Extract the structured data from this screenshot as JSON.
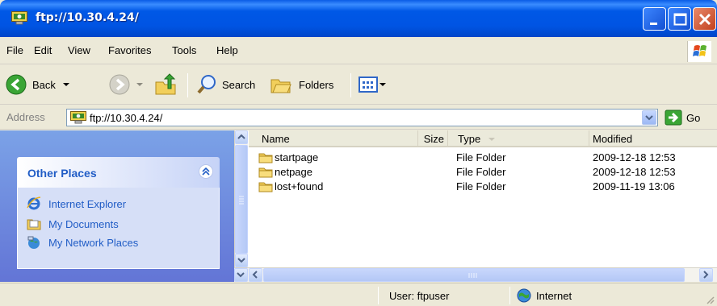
{
  "window": {
    "title": "ftp://10.30.4.24/"
  },
  "menu": {
    "items": [
      "File",
      "Edit",
      "View",
      "Favorites",
      "Tools",
      "Help"
    ]
  },
  "toolbar": {
    "back_label": "Back",
    "search_label": "Search",
    "folders_label": "Folders"
  },
  "address": {
    "label": "Address",
    "value": "ftp://10.30.4.24/",
    "go_label": "Go"
  },
  "taskpane": {
    "other_places_title": "Other Places",
    "places": [
      "Internet Explorer",
      "My Documents",
      "My Network Places"
    ]
  },
  "filelist": {
    "columns": [
      "Name",
      "Size",
      "Type",
      "Modified"
    ],
    "rows": [
      {
        "name": "startpage",
        "size": "",
        "type": "File Folder",
        "modified": "2009-12-18 12:53"
      },
      {
        "name": "netpage",
        "size": "",
        "type": "File Folder",
        "modified": "2009-12-18 12:53"
      },
      {
        "name": "lost+found",
        "size": "",
        "type": "File Folder",
        "modified": "2009-11-19 13:06"
      }
    ]
  },
  "status": {
    "user": "User: ftpuser",
    "zone": "Internet"
  },
  "icons": {
    "title": "ftp-folder-icon",
    "back": "back-arrow-icon",
    "forward": "forward-arrow-icon",
    "up": "up-folder-icon",
    "search": "magnifier-icon",
    "folders": "folders-icon",
    "views": "views-icon",
    "go": "go-arrow-icon",
    "ie": "internet-explorer-icon",
    "docs": "my-documents-icon",
    "network": "network-places-icon",
    "folder": "folder-icon",
    "globe": "internet-globe-icon"
  },
  "colors": {
    "titlebar": "#0054e3",
    "taskpane_link": "#215dc6",
    "taskpane_bg": "#6f8fe0"
  }
}
